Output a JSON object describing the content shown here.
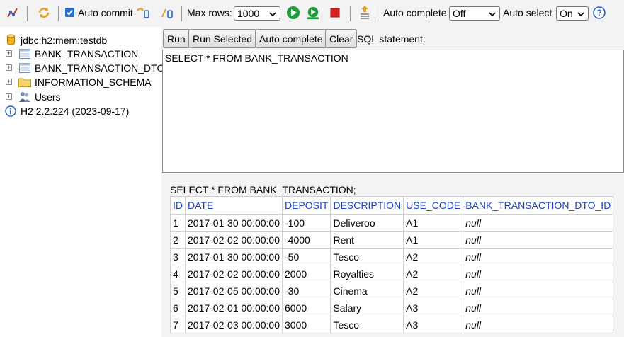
{
  "toolbar": {
    "auto_commit_label": "Auto commit",
    "auto_commit_checked": true,
    "max_rows_label": "Max rows:",
    "max_rows_value": "1000",
    "auto_complete_label": "Auto complete",
    "auto_complete_value": "Off",
    "auto_select_label": "Auto select",
    "auto_select_value": "On",
    "icons": [
      "disconnect-icon",
      "refresh-icon",
      "rollback-icon",
      "commit-icon",
      "run-icon",
      "run-selected-icon",
      "stop-icon",
      "history-icon",
      "help-icon"
    ]
  },
  "tree": {
    "connection": "jdbc:h2:mem:testdb",
    "items": [
      {
        "label": "BANK_TRANSACTION",
        "icon": "table-icon"
      },
      {
        "label": "BANK_TRANSACTION_DTO",
        "icon": "table-icon"
      },
      {
        "label": "INFORMATION_SCHEMA",
        "icon": "folder-icon"
      },
      {
        "label": "Users",
        "icon": "users-icon"
      }
    ],
    "version": "H2 2.2.224 (2023-09-17)"
  },
  "buttons": {
    "run": "Run",
    "run_selected": "Run Selected",
    "auto_complete": "Auto complete",
    "clear": "Clear"
  },
  "sql_label": "SQL statement:",
  "editor_text": "SELECT * FROM BANK_TRANSACTION",
  "result": {
    "query": "SELECT * FROM BANK_TRANSACTION;",
    "columns": [
      "ID",
      "DATE",
      "DEPOSIT",
      "DESCRIPTION",
      "USE_CODE",
      "BANK_TRANSACTION_DTO_ID"
    ],
    "rows": [
      [
        "1",
        "2017-01-30 00:00:00",
        "-100",
        "Deliveroo",
        "A1",
        "null"
      ],
      [
        "2",
        "2017-02-02 00:00:00",
        "-4000",
        "Rent",
        "A1",
        "null"
      ],
      [
        "3",
        "2017-01-30 00:00:00",
        "-50",
        "Tesco",
        "A2",
        "null"
      ],
      [
        "4",
        "2017-02-02 00:00:00",
        "2000",
        "Royalties",
        "A2",
        "null"
      ],
      [
        "5",
        "2017-02-05 00:00:00",
        "-30",
        "Cinema",
        "A2",
        "null"
      ],
      [
        "6",
        "2017-02-01 00:00:00",
        "6000",
        "Salary",
        "A3",
        "null"
      ],
      [
        "7",
        "2017-02-03 00:00:00",
        "3000",
        "Tesco",
        "A3",
        "null"
      ]
    ]
  },
  "colors": {
    "toolbar_bg": "#f3f3f3",
    "header_text": "#1a44c4",
    "checkbox": "#1f6fd6",
    "run_green": "#1e9b3c",
    "stop_red": "#d62222"
  }
}
